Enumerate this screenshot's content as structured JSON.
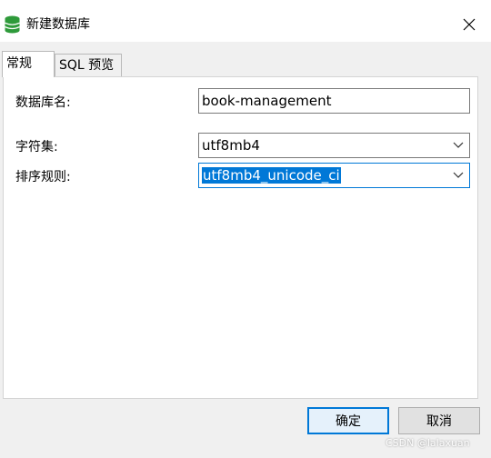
{
  "window": {
    "title": "新建数据库",
    "icon": "database-icon"
  },
  "tabs": [
    {
      "label": "常规",
      "active": true
    },
    {
      "label": "SQL 预览",
      "active": false
    }
  ],
  "form": {
    "db_name_label": "数据库名:",
    "db_name_value": "book-management",
    "charset_label": "字符集:",
    "charset_value": "utf8mb4",
    "collation_label": "排序规则:",
    "collation_value": "utf8mb4_unicode_ci"
  },
  "buttons": {
    "ok": "确定",
    "cancel": "取消"
  },
  "watermark": "CSDN @lalaxuan",
  "colors": {
    "accent": "#0078d7",
    "icon_green": "#2e9a3a"
  }
}
